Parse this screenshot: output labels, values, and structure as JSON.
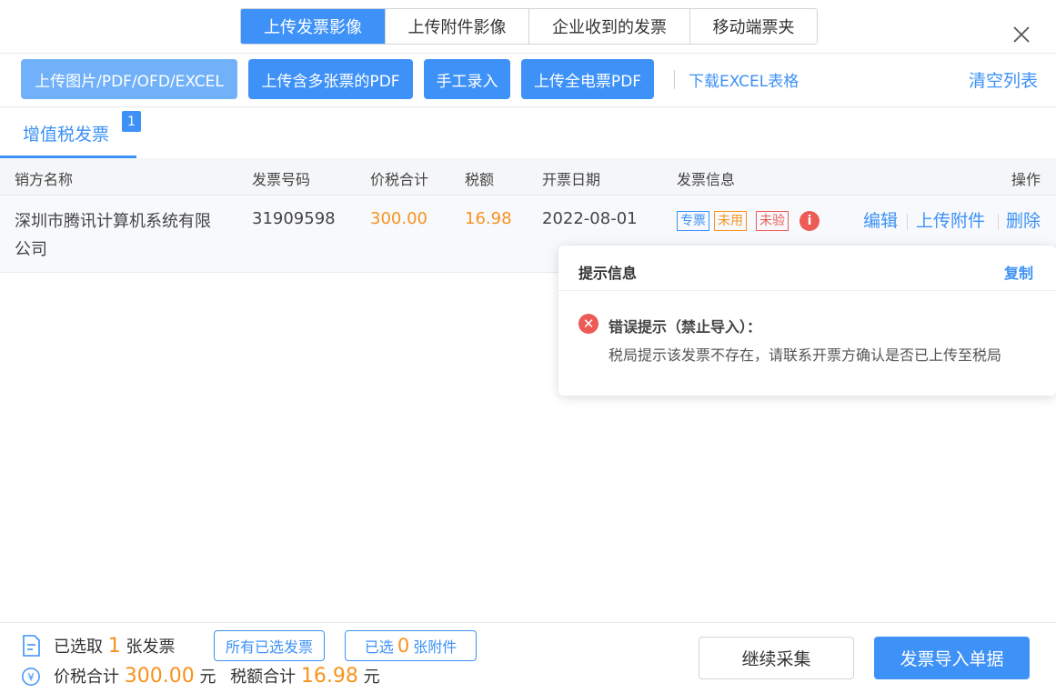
{
  "top_tabs": [
    {
      "label": "上传发票影像",
      "active": true
    },
    {
      "label": "上传附件影像",
      "active": false
    },
    {
      "label": "企业收到的发票",
      "active": false
    },
    {
      "label": "移动端票夹",
      "active": false
    }
  ],
  "toolbar": {
    "upload_image_label": "上传图片/PDF/OFD/EXCEL",
    "upload_multi_pdf_label": "上传含多张票的PDF",
    "manual_entry_label": "手工录入",
    "upload_all_electric_label": "上传全电票PDF",
    "download_excel_label": "下载EXCEL表格",
    "clear_list_label": "清空列表"
  },
  "subtab": {
    "label": "增值税发票",
    "badge": "1"
  },
  "table": {
    "headers": {
      "seller": "销方名称",
      "invoice_no": "发票号码",
      "total": "价税合计",
      "tax": "税额",
      "date": "开票日期",
      "info": "发票信息",
      "actions": "操作"
    },
    "rows": [
      {
        "seller": "深圳市腾讯计算机系统有限公司",
        "invoice_no": "31909598",
        "total": "300.00",
        "tax": "16.98",
        "date": "2022-08-01",
        "tags": [
          "专票",
          "未用",
          "未验"
        ],
        "actions": [
          "编辑",
          "上传附件",
          "删除"
        ]
      }
    ]
  },
  "popover": {
    "title": "提示信息",
    "copy_label": "复制",
    "error_title": "错误提示（禁止导入）：",
    "error_message": "税局提示该发票不存在，请联系开票方确认是否已上传至税局"
  },
  "footer": {
    "selected_prefix": "已选取",
    "selected_count": "1",
    "selected_suffix": "张发票",
    "all_selected_label": "所有已选发票",
    "attach_prefix": "已选",
    "attach_count": "0",
    "attach_suffix": "张附件",
    "total_label": "价税合计",
    "total_value": "300.00",
    "total_unit": "元",
    "tax_label": "税额合计",
    "tax_value": "16.98",
    "tax_unit": "元",
    "continue_label": "继续采集",
    "import_label": "发票导入单据"
  },
  "colors": {
    "primary": "#3d91f7",
    "orange": "#f7931e",
    "red": "#ec5b56"
  }
}
